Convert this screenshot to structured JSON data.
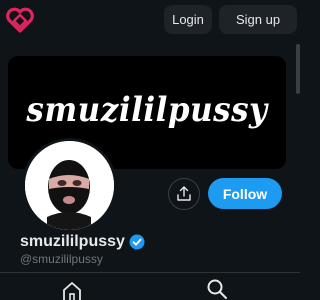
{
  "topbar": {
    "logo_icon": "heart-logo-icon",
    "login_label": "Login",
    "signup_label": "Sign up"
  },
  "banner": {
    "text": "smuzililpussy"
  },
  "profile": {
    "display_name": "smuzililpussy",
    "handle": "@smuzililpussy",
    "verified": true,
    "follow_label": "Follow",
    "share_icon": "share-icon"
  },
  "bottom_nav": {
    "items": [
      "home-icon",
      "search-icon"
    ]
  },
  "colors": {
    "background": "#0f1419",
    "accent": "#1d9bf0",
    "logo": "#e0245e"
  }
}
